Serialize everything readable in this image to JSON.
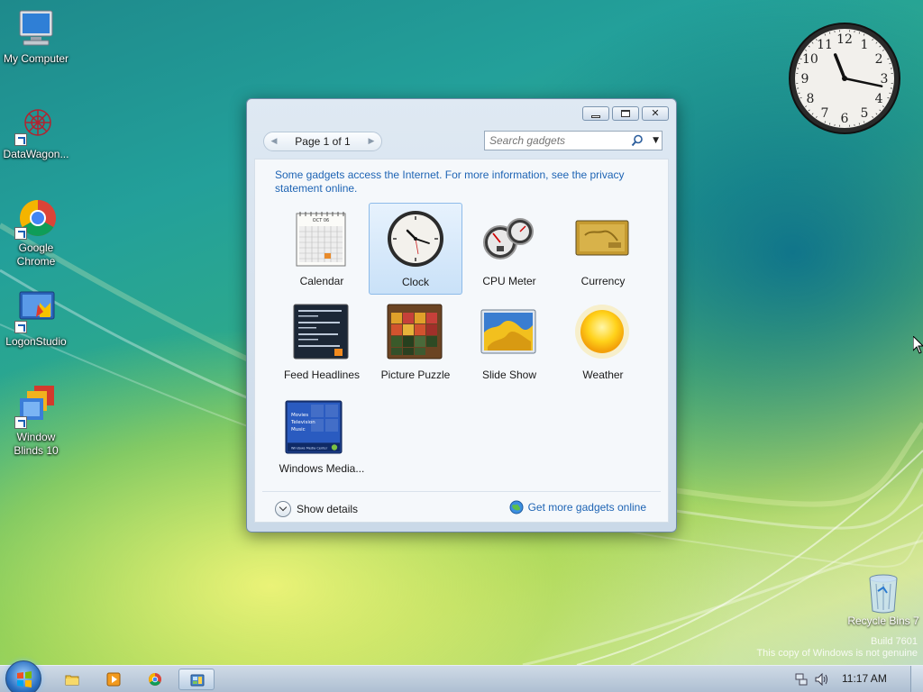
{
  "desktop": {
    "icons": [
      {
        "label": "My Computer"
      },
      {
        "label": "DataWagon..."
      },
      {
        "label": "Google Chrome"
      },
      {
        "label": "LogonStudio"
      },
      {
        "label": "Window Blinds 10"
      }
    ],
    "recycle_bin": {
      "label": "Recycle Bins 7"
    },
    "watermark": {
      "line1": "Build 7601",
      "line2": "This copy of Windows is not genuine"
    }
  },
  "gadget_window": {
    "pager": {
      "label": "Page 1 of 1"
    },
    "search": {
      "placeholder": "Search gadgets"
    },
    "notice": "Some gadgets access the Internet.  For more information, see the privacy statement online.",
    "gadgets": [
      {
        "label": "Calendar",
        "selected": false
      },
      {
        "label": "Clock",
        "selected": true
      },
      {
        "label": "CPU Meter",
        "selected": false
      },
      {
        "label": "Currency",
        "selected": false
      },
      {
        "label": "Feed Headlines",
        "selected": false
      },
      {
        "label": "Picture Puzzle",
        "selected": false
      },
      {
        "label": "Slide Show",
        "selected": false
      },
      {
        "label": "Weather",
        "selected": false
      },
      {
        "label": "Windows Media...",
        "selected": false
      }
    ],
    "calendar_thumb": {
      "month": "OCT 06"
    },
    "media_thumb": {
      "items": [
        "Movies",
        "Television",
        "Music"
      ],
      "footer": "Windows Media Center"
    },
    "footer": {
      "show_details": "Show details",
      "more_gadgets": "Get more gadgets online"
    }
  },
  "desktop_clock": {
    "numerals": [
      "12",
      "1",
      "2",
      "3",
      "4",
      "5",
      "6",
      "7",
      "8",
      "9",
      "10",
      "11"
    ],
    "hour": 11,
    "minute": 17
  },
  "taskbar": {
    "time": "11:17 AM"
  },
  "colors": {
    "link": "#1e64b4",
    "selection": "#c9e1f8",
    "window_frame": "#6f8aa6"
  }
}
